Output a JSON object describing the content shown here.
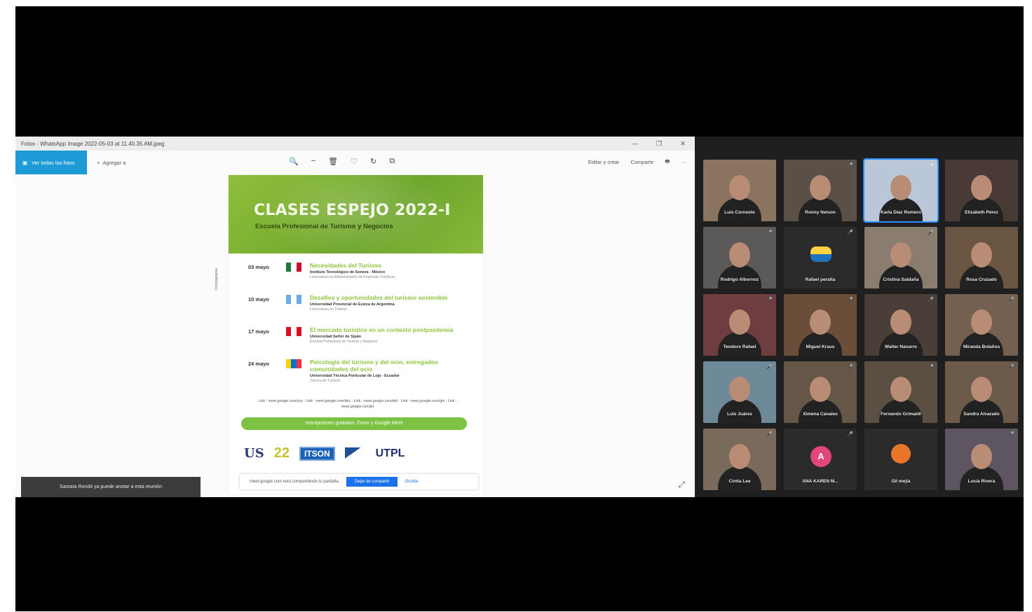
{
  "viewer": {
    "title": "Fotos - WhatsApp Image 2022-05-03 at 11.40.35 AM.jpeg",
    "window_controls": [
      "—",
      "❐",
      "✕"
    ],
    "edit_button": "Ver todas las fotos",
    "add_to": "Agregar a",
    "edit_create": "Editar y crear",
    "share": "Compartir",
    "print_icon": "🖶",
    "more": "···"
  },
  "flyer": {
    "title": "CLASES ESPEJO 2022-I",
    "subtitle": "Escuela Profesional de Turismo y Negocios",
    "vertical_label": "Cronograma",
    "schedule": [
      {
        "date": "03 mayo",
        "topic": "Necesidades del Turismo",
        "institution": "Instituto Tecnológico de Sonora - México",
        "extra": "Licenciatura en Administración de Empresas Turísticas",
        "flag": [
          "#1e7a3c",
          "#ffffff",
          "#c8102e"
        ]
      },
      {
        "date": "10 mayo",
        "topic": "Desafíos y oportunidades del turismo sostenible",
        "institution": "Universidad Provincial de Ezeiza de Argentina",
        "extra": "Licenciatura en Turismo",
        "flag": [
          "#6cace4",
          "#ffffff",
          "#6cace4"
        ]
      },
      {
        "date": "17 mayo",
        "topic": "El mercado turístico en un contexto postpandemia",
        "institution": "Universidad Señor de Sipán",
        "extra": "Escuela Profesional de Turismo y Negocios",
        "flag": [
          "#d91023",
          "#ffffff",
          "#d91023"
        ]
      },
      {
        "date": "24 mayo",
        "topic": "Psicología del turismo y del ocio, entregados comunidades del ocio",
        "institution": "Universidad Técnica Particular de Loja - Ecuador",
        "extra": "Carrera de Turismo",
        "flag": [
          "#ffd100",
          "#0072ce",
          "#ef3340"
        ]
      }
    ],
    "links": "Link - meet.google.com/xyz · Link - meet.google.com/abc · Link - meet.google.com/def · Link - meet.google.com/ghi · Link - meet.google.com/jkl",
    "register": "Inscripciones gratuitas: Zoom y Google Meet",
    "logos": {
      "us": "US",
      "years": "22",
      "tec": "ITSON",
      "utpl": "UTPL"
    }
  },
  "notification": {
    "message": "meet.google.com está compartiendo tu pantalla.",
    "stop_button": "Dejar de compartir",
    "hide": "Ocultar"
  },
  "toast": "Samara Rondó ya puede anotar a esta reunión",
  "expand_icon": "⤢",
  "participants": [
    {
      "name": "Luis Corneolo",
      "mic": "",
      "color": "#8a7460"
    },
    {
      "name": "Ronny Nelson",
      "mic": "🎤",
      "color": "#5a5048"
    },
    {
      "name": "Karla Diaz Romero",
      "mic": "●",
      "color": "#b9c7d8",
      "active": true
    },
    {
      "name": "Elizabeth Pérez",
      "mic": "",
      "color": "#4a3a36"
    },
    {
      "name": "Rodrigo Albornoz",
      "mic": "🎤",
      "color": "#5c5a58"
    },
    {
      "name": "Rafael peralta",
      "mic": "🎤",
      "kind": "logo"
    },
    {
      "name": "Cristina Saldaña",
      "mic": "🎤",
      "color": "#8a7c6e"
    },
    {
      "name": "Rosa Cruzado",
      "mic": "",
      "color": "#6a5442"
    },
    {
      "name": "Teodoro Rafael",
      "mic": "🎤",
      "color": "#6d3d3f"
    },
    {
      "name": "Miguel Kraus",
      "mic": "🎤",
      "color": "#6a4e3a"
    },
    {
      "name": "Walter Navarro",
      "mic": "🎤",
      "color": "#4a3e38"
    },
    {
      "name": "Miranda Bolaños",
      "mic": "🎤",
      "color": "#736050"
    },
    {
      "name": "Luis Juárez",
      "mic": "🎤",
      "color": "#6e8a98"
    },
    {
      "name": "Ximena Canales",
      "mic": "🎤",
      "color": "#655648"
    },
    {
      "name": "Fernando Grimaldi",
      "mic": "🎤",
      "color": "#5b4f43"
    },
    {
      "name": "Sandra Alvarado",
      "mic": "🎤",
      "color": "#6c5a4a"
    },
    {
      "name": "Cintia Lee",
      "mic": "🎤",
      "color": "#7a6a5c"
    },
    {
      "name": "ANA KAREN M...",
      "mic": "🎤",
      "kind": "avatar",
      "initial": "A"
    },
    {
      "name": "Gil mejía",
      "mic": "",
      "kind": "orange"
    },
    {
      "name": "Lucía Rivera",
      "mic": "🎤",
      "color": "#5d5560"
    }
  ]
}
